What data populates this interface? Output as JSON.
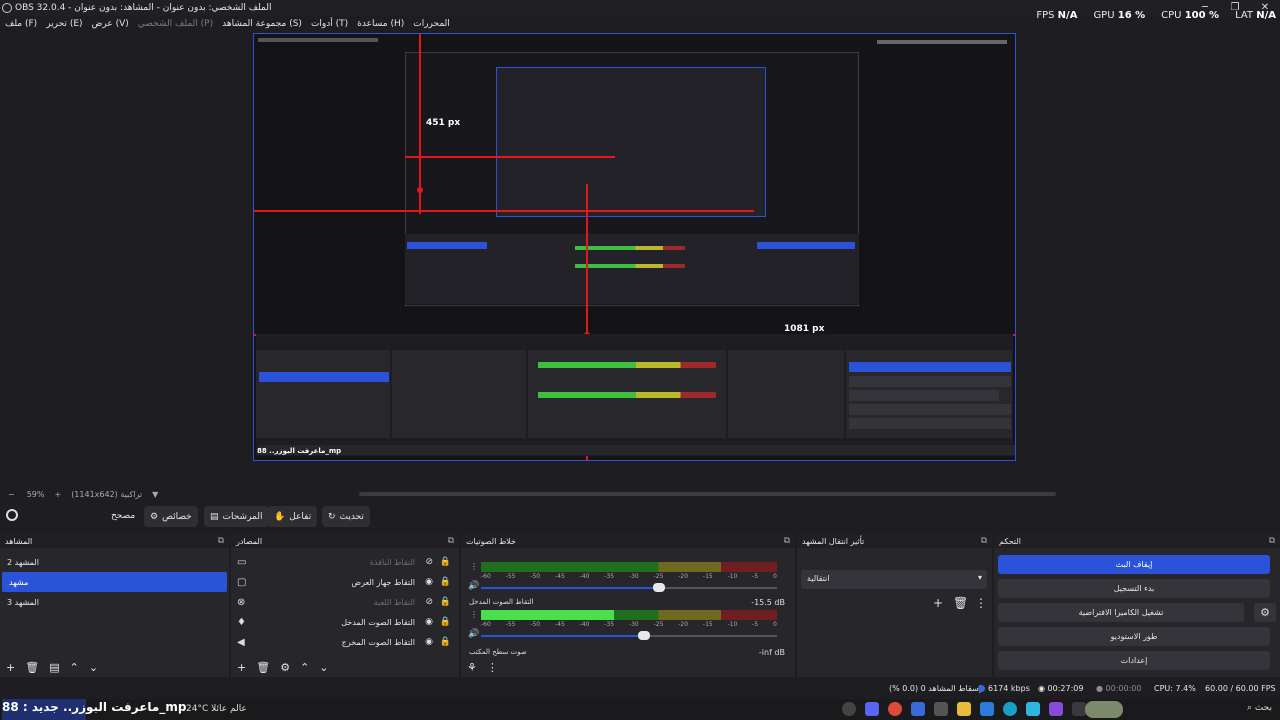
{
  "window": {
    "title": "OBS 32.0.4 - الملف الشخصي: بدون عنوان - المشاهد: بدون عنوان",
    "minimize": "─",
    "maximize": "❐",
    "close": "✕"
  },
  "menu": [
    "ملف (F)",
    "تحرير (E)",
    "عرض (V)",
    "الملف الشخصي (P)",
    "مجموعة المشاهد (S)",
    "أدوات (T)",
    "مساعدة (H)",
    "المحررات"
  ],
  "menu_disabled_index": 3,
  "stats": {
    "fps_label": "FPS",
    "fps_value": "N/A",
    "gpu_label": "GPU",
    "gpu_value": "16 %",
    "cpu_label": "CPU",
    "cpu_value": "100 %",
    "lat_label": "LAT",
    "lat_value": "N/A"
  },
  "preview": {
    "label_451": "451 px",
    "label_1081": "1081 px",
    "nested_overlay": "ماعرفت البوزر.. 88_mp"
  },
  "zoombar": {
    "minus": "−",
    "zoom": "59%",
    "plus": "+",
    "resolution": "(1141x642) تراكبية"
  },
  "toolbar": {
    "gear": "",
    "studio": "مصحح",
    "properties": "خصائص",
    "filters": "المرشحات",
    "interact": "تفاعل",
    "refresh": "تحديث"
  },
  "scenes": {
    "title": "المشاهد",
    "items": [
      "المشهد 2",
      "مشهد",
      "المشهد 3"
    ],
    "active_index": 1
  },
  "sources": {
    "title": "المصادر",
    "items": [
      {
        "label": "التقاط النافذة",
        "icon": "window-icon",
        "glyph": "▭",
        "visible": false
      },
      {
        "label": "التقاط جهاز العرض",
        "icon": "monitor-icon",
        "glyph": "▢",
        "visible": true
      },
      {
        "label": "التقاط اللعبة",
        "icon": "gamepad-icon",
        "glyph": "⊗",
        "visible": false
      },
      {
        "label": "التقاط الصوت المدخل",
        "icon": "microphone-icon",
        "glyph": "♦",
        "visible": true
      },
      {
        "label": "التقاط الصوت المخرج",
        "icon": "speaker-icon",
        "glyph": "◀",
        "visible": true
      }
    ]
  },
  "mixer": {
    "title": "خلاط الصوتيات",
    "scale": [
      "-60",
      "-55",
      "-50",
      "-45",
      "-40",
      "-35",
      "-30",
      "-25",
      "-20",
      "-15",
      "-10",
      "-5",
      "0"
    ],
    "channels": [
      {
        "name": "",
        "db": "",
        "level": 0,
        "volume": 0.6
      },
      {
        "name": "التقاط الصوت المدخل",
        "db": "-15.5 dB",
        "level": 0.45,
        "volume": 0.55
      },
      {
        "name": "صوت سطح المكتب",
        "db": "-inf dB",
        "level": 0,
        "volume": 0
      }
    ]
  },
  "transitions": {
    "title": "تأثير انتقال المشهد",
    "selected": "انتقالية"
  },
  "controls": {
    "title": "التحكم",
    "stop_stream": "إيقاف البث",
    "start_record": "بدء التسجيل",
    "virtual_cam": "تشغيل الكاميرا الافتراضية",
    "studio_mode": "طور الاستوديو",
    "settings": "إعدادات"
  },
  "statusbar": {
    "dropped": "إسقاط المشاهد 0 (0.0 %)",
    "bitrate": "6174 kbps",
    "stream_time": "00:27:09",
    "rec_time": "00:00:00",
    "cpu": "CPU: 7.4%",
    "fps": "60.00 / 60.00 FPS"
  },
  "taskbar": {
    "overlay_text": "ماعرفت البوزر.. جديد : 88_mp",
    "weather": "24°C عالم عائلا",
    "search": "بحث"
  },
  "colors": {
    "accent": "#2b53d9",
    "red_guides": "#e01818",
    "meter_green": "#49e049"
  }
}
